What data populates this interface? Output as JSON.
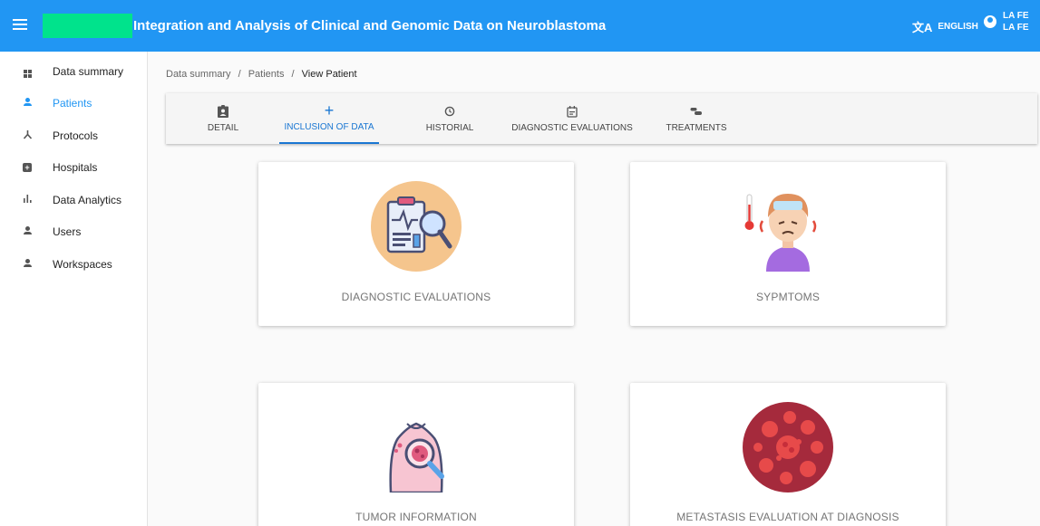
{
  "header": {
    "title": "Integration and Analysis of Clinical and Genomic Data on Neuroblastoma",
    "language": "ENGLISH",
    "user_line1": "LA FE",
    "user_line2": "LA FE",
    "brand_color": "#2196f3",
    "logo_color": "#00e38c"
  },
  "sidebar": {
    "items": [
      {
        "label": "Data summary",
        "icon": "dashboard-icon"
      },
      {
        "label": "Patients",
        "icon": "person-icon",
        "active": true
      },
      {
        "label": "Protocols",
        "icon": "share-icon"
      },
      {
        "label": "Hospitals",
        "icon": "hospital-icon"
      },
      {
        "label": "Data Analytics",
        "icon": "bar-chart-icon"
      },
      {
        "label": "Users",
        "icon": "person-icon"
      },
      {
        "label": "Workspaces",
        "icon": "person-icon"
      }
    ]
  },
  "breadcrumb": {
    "items": [
      "Data summary",
      "Patients",
      "View Patient"
    ],
    "separator": "/"
  },
  "tabs": [
    {
      "label": "DETAIL",
      "icon": "clipboard-person-icon"
    },
    {
      "label": "INCLUSION OF DATA",
      "icon": "plus-icon",
      "active": true
    },
    {
      "label": "HISTORIAL",
      "icon": "history-icon"
    },
    {
      "label": "DIAGNOSTIC EVALUATIONS",
      "icon": "calendar-icon"
    },
    {
      "label": "TREATMENTS",
      "icon": "pills-icon"
    }
  ],
  "cards": [
    {
      "title": "DIAGNOSTIC EVALUATIONS",
      "icon": "clipboard-magnifier-icon"
    },
    {
      "title": "SYPMTOMS",
      "icon": "sick-child-icon"
    },
    {
      "title": "TUMOR INFORMATION",
      "icon": "body-tumor-icon"
    },
    {
      "title": "METASTASIS EVALUATION AT DIAGNOSIS",
      "icon": "metastasis-cells-icon"
    }
  ]
}
